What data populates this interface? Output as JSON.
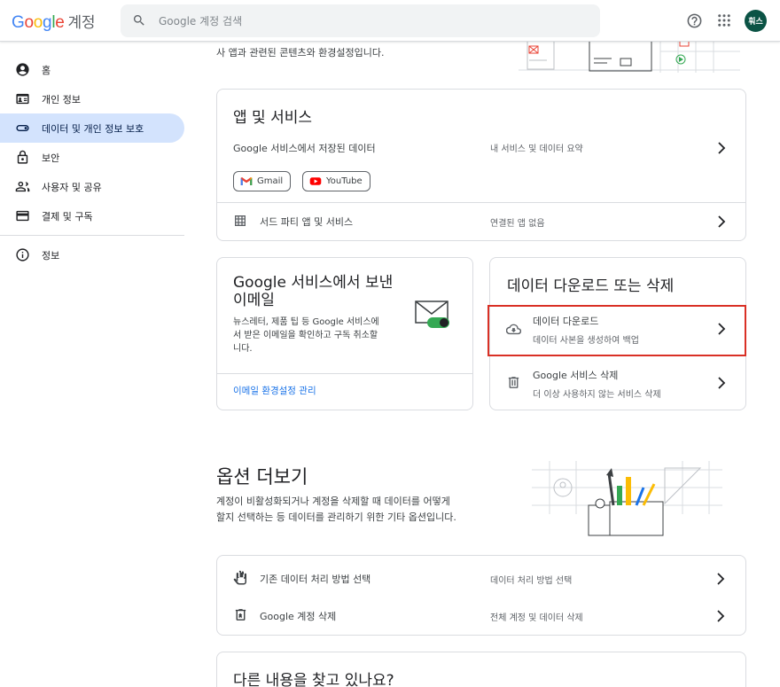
{
  "header": {
    "logo_parts": [
      "G",
      "o",
      "o",
      "g",
      "l",
      "e"
    ],
    "logo_suffix": "계정",
    "search_placeholder": "Google 계정 검색",
    "avatar_initials": "훠스"
  },
  "sidebar": {
    "items": [
      {
        "label": "홈",
        "icon": "account-circle-icon"
      },
      {
        "label": "개인 정보",
        "icon": "id-card-icon"
      },
      {
        "label": "데이터 및 개인 정보 보호",
        "icon": "toggle-icon",
        "active": true
      },
      {
        "label": "보안",
        "icon": "lock-icon"
      },
      {
        "label": "사용자 및 공유",
        "icon": "people-icon"
      },
      {
        "label": "결제 및 구독",
        "icon": "credit-card-icon"
      }
    ],
    "info_label": "정보"
  },
  "intro": {
    "line2": "사 앱과 관련된 콘텐츠와 환경설정입니다."
  },
  "apps_card": {
    "title": "앱 및 서비스",
    "row1_label": "Google 서비스에서 저장된 데이터",
    "row1_value": "내 서비스 및 데이터 요약",
    "chips": [
      "Gmail",
      "YouTube"
    ],
    "row2_label": "서드 파티 앱 및 서비스",
    "row2_value": "연결된 앱 없음"
  },
  "email_card": {
    "title_line1": "Google 서비스에서 보낸",
    "title_line2": "이메일",
    "desc_line1": "뉴스레터, 제품 팁 등 Google 서비스에",
    "desc_line2": "서 받은 이메일을 확인하고 구독 취소할",
    "desc_line3": "니다.",
    "link": "이메일 환경설정 관리"
  },
  "download_card": {
    "title": "데이터 다운로드 또는 삭제",
    "download_label": "데이터 다운로드",
    "download_sub": "데이터 사본을 생성하여 백업",
    "delete_label": "Google 서비스 삭제",
    "delete_sub": "더 이상 사용하지 않는 서비스 삭제"
  },
  "more_options": {
    "title": "옵션 더보기",
    "desc_line1": "계정이 비활성화되거나 계정을 삭제할 때 데이터를 어떻게",
    "desc_line2": "할지 선택하는 등 데이터를 관리하기 위한 기타 옵션입니다."
  },
  "options_card": {
    "row1_label": "기존 데이터 처리 방법 선택",
    "row1_value": "데이터 처리 방법 선택",
    "row2_label": "Google 계정 삭제",
    "row2_value": "전체 계정 및 데이터 삭제"
  },
  "looking_card": {
    "title": "다른 내용을 찾고 있나요?"
  },
  "colors": {
    "accent": "#1a73e8",
    "active_nav": "#d3e3fd",
    "highlight": "#d93025",
    "avatar": "#0b5345"
  }
}
